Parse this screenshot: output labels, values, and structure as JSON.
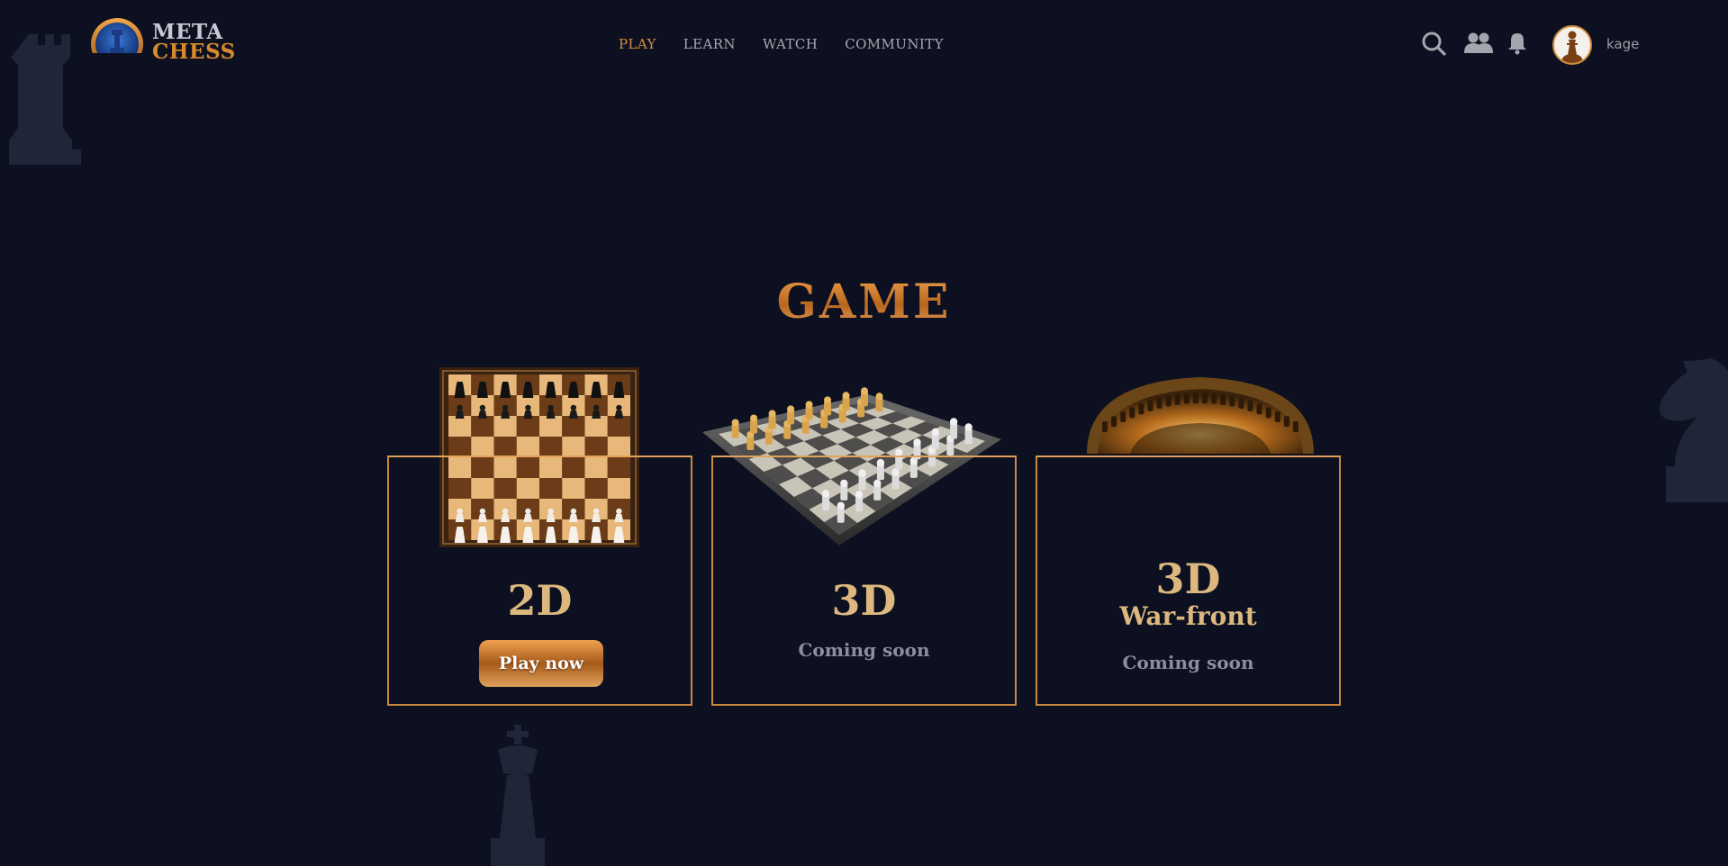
{
  "brand": {
    "logo_line1": "META",
    "logo_line2": "CHESS"
  },
  "nav": {
    "items": [
      {
        "label": "PLAY",
        "active": true
      },
      {
        "label": "LEARN",
        "active": false
      },
      {
        "label": "WATCH",
        "active": false
      },
      {
        "label": "COMMUNITY",
        "active": false
      }
    ]
  },
  "header": {
    "icons": [
      "search-icon",
      "friends-icon",
      "bell-icon"
    ],
    "username": "kage"
  },
  "main": {
    "title": "GAME",
    "cards": [
      {
        "title": "2D",
        "button_label": "Play now",
        "image": "2d-chessboard"
      },
      {
        "title": "3D",
        "status": "Coming soon",
        "image": "3d-chessboard"
      },
      {
        "title": "3D",
        "subtitle": "War-front",
        "status": "Coming soon",
        "image": "colosseum-arena"
      }
    ]
  },
  "colors": {
    "background": "#0c1020",
    "accent": "#d49043",
    "card_border": "#c9893d",
    "card_text": "#dcb87f",
    "muted_text": "#8b8f9b"
  }
}
